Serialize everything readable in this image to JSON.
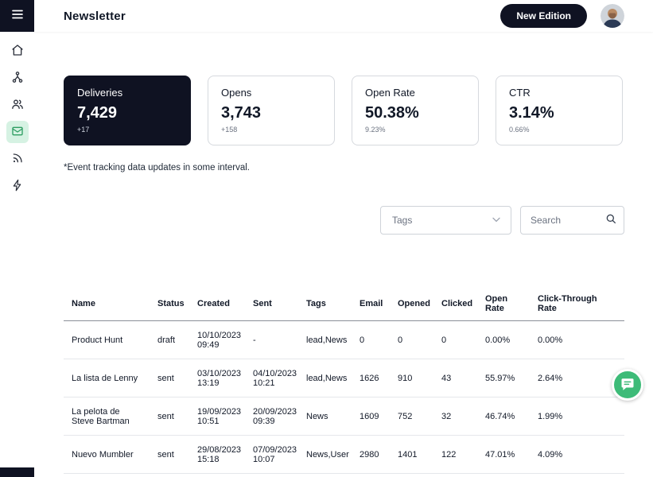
{
  "header": {
    "title": "Newsletter",
    "new_edition_label": "New Edition"
  },
  "sidebar": {
    "icons": [
      "menu-icon",
      "home-icon",
      "hierarchy-icon",
      "users-icon",
      "email-icon",
      "rss-icon",
      "lightning-icon"
    ],
    "active_item": "email"
  },
  "stats": {
    "cards": [
      {
        "label": "Deliveries",
        "value": "7,429",
        "delta": "+17"
      },
      {
        "label": "Opens",
        "value": "3,743",
        "delta": "+158"
      },
      {
        "label": "Open Rate",
        "value": "50.38%",
        "delta": "9.23%"
      },
      {
        "label": "CTR",
        "value": "3.14%",
        "delta": "0.66%"
      }
    ]
  },
  "note": "*Event tracking data updates in some interval.",
  "filters": {
    "tags_label": "Tags",
    "search_placeholder": "Search"
  },
  "table": {
    "columns": [
      "Name",
      "Status",
      "Created",
      "Sent",
      "Tags",
      "Email",
      "Opened",
      "Clicked",
      "Open Rate",
      "Click-Through Rate"
    ],
    "rows": [
      {
        "name": "Product Hunt",
        "status": "draft",
        "created": "10/10/2023\n09:49",
        "sent": "-",
        "tags": "lead,News",
        "email": "0",
        "opened": "0",
        "clicked": "0",
        "open_rate": "0.00%",
        "ctr": "0.00%"
      },
      {
        "name": "La lista de Lenny",
        "status": "sent",
        "created": "03/10/2023\n13:19",
        "sent": "04/10/2023\n10:21",
        "tags": "lead,News",
        "email": "1626",
        "opened": "910",
        "clicked": "43",
        "open_rate": "55.97%",
        "ctr": "2.64%"
      },
      {
        "name": "La pelota de Steve Bartman",
        "status": "sent",
        "created": "19/09/2023\n10:51",
        "sent": "20/09/2023\n09:39",
        "tags": "News",
        "email": "1609",
        "opened": "752",
        "clicked": "32",
        "open_rate": "46.74%",
        "ctr": "1.99%"
      },
      {
        "name": "Nuevo Mumbler",
        "status": "sent",
        "created": "29/08/2023\n15:18",
        "sent": "07/09/2023\n10:07",
        "tags": "News,User",
        "email": "2980",
        "opened": "1401",
        "clicked": "122",
        "open_rate": "47.01%",
        "ctr": "4.09%"
      }
    ]
  },
  "colors": {
    "dark_navy": "#0f1222",
    "accent_green": "#3dbb78",
    "active_icon_bg": "#d6f2e3",
    "card_border": "#d6d9de"
  }
}
